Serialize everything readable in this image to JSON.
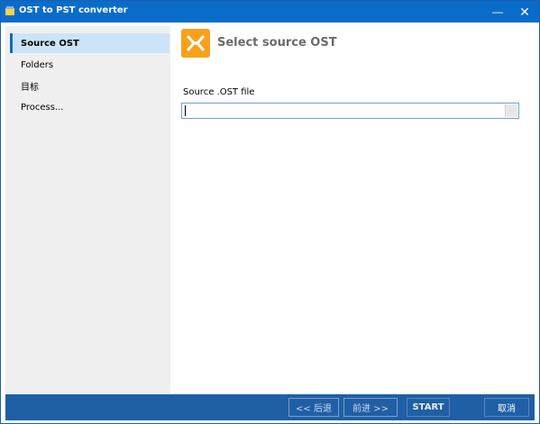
{
  "window": {
    "title": "OST to PST converter",
    "minimize_icon": "minimize-icon",
    "close_icon": "close-icon"
  },
  "sidebar": {
    "items": [
      {
        "label": "Source OST",
        "active": true
      },
      {
        "label": "Folders",
        "active": false
      },
      {
        "label": "目标",
        "active": false
      },
      {
        "label": "Process...",
        "active": false
      }
    ]
  },
  "main": {
    "header_icon": "outlook-icon",
    "title": "Select source OST",
    "field_label": "Source .OST file",
    "field_value": ""
  },
  "footer": {
    "back_label": "<< 后退",
    "next_label": "前进 >>",
    "start_label": "START",
    "cancel_label": "取消"
  },
  "colors": {
    "titlebar": "#0a6cc9",
    "footer": "#1f5fa6",
    "sidebar": "#f0f0f0",
    "active_item": "#cce4f7",
    "header_icon": "#f7a21a"
  }
}
